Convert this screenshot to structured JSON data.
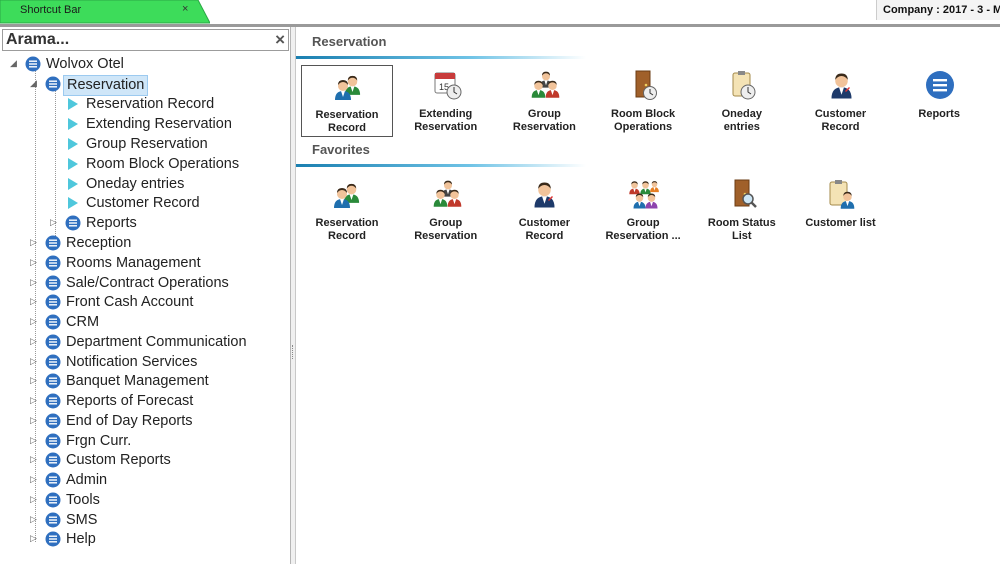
{
  "topbar": {
    "tab_label": "Shortcut Bar",
    "tab_close": "×",
    "company_text": "Company : 2017 - 3 - M",
    "colors": {
      "tab_green": "#3ddc5a"
    }
  },
  "sidebar": {
    "search_placeholder": "Arama...",
    "clear_glyph": "×",
    "root": "Wolvox Otel",
    "selected": "Reservation",
    "reservation_children": [
      "Reservation Record",
      "Extending Reservation",
      "Group Reservation",
      "Room Block Operations",
      "Oneday entries",
      "Customer Record",
      "Reports"
    ],
    "modules": [
      "Reservation",
      "Reception",
      "Rooms Management",
      "Sale/Contract Operations",
      "Front Cash Account",
      "CRM",
      "Department Communication",
      "Notification Services",
      "Banquet Management",
      "Reports of Forecast",
      "End of Day Reports",
      "Frgn Curr.",
      "Custom Reports",
      "Admin",
      "Tools",
      "SMS",
      "Help"
    ]
  },
  "main": {
    "sections": [
      {
        "title": "Reservation",
        "items": [
          {
            "line1": "Reservation",
            "line2": "Record",
            "icon": "reservation-record-icon"
          },
          {
            "line1": "Extending",
            "line2": "Reservation",
            "icon": "calendar-clock-icon"
          },
          {
            "line1": "Group",
            "line2": "Reservation",
            "icon": "group-icon"
          },
          {
            "line1": "Room Block",
            "line2": "Operations",
            "icon": "door-clock-icon"
          },
          {
            "line1": "Oneday",
            "line2": "entries",
            "icon": "clipboard-clock-icon"
          },
          {
            "line1": "Customer",
            "line2": "Record",
            "icon": "customer-icon"
          },
          {
            "line1": "Reports",
            "line2": "",
            "icon": "list-circle-icon"
          }
        ]
      },
      {
        "title": "Favorites",
        "items": [
          {
            "line1": "Reservation",
            "line2": "Record",
            "icon": "reservation-record-icon"
          },
          {
            "line1": "Group",
            "line2": "Reservation",
            "icon": "group-icon"
          },
          {
            "line1": "Customer",
            "line2": "Record",
            "icon": "customer-icon"
          },
          {
            "line1": "Group",
            "line2": "Reservation ...",
            "icon": "group-large-icon"
          },
          {
            "line1": "Room Status",
            "line2": "List",
            "icon": "door-search-icon"
          },
          {
            "line1": "Customer list",
            "line2": "",
            "icon": "clipboard-person-icon"
          }
        ]
      }
    ]
  }
}
